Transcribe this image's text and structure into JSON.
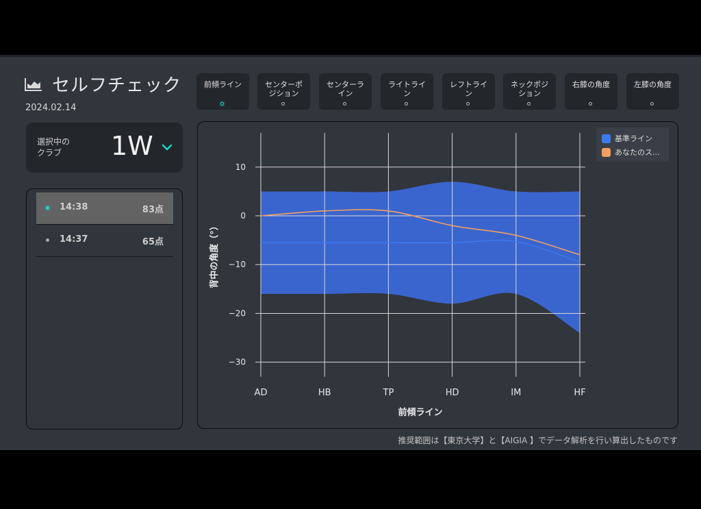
{
  "header": {
    "title": "セルフチェック",
    "date": "2024.02.14"
  },
  "club": {
    "label": "選択中の\nクラブ",
    "value": "1W"
  },
  "history": [
    {
      "time": "14:38",
      "score": "83点",
      "active": true
    },
    {
      "time": "14:37",
      "score": "65点",
      "active": false
    }
  ],
  "tabs": [
    {
      "label": "前傾ライン",
      "active": true
    },
    {
      "label": "センターポ\nジション",
      "active": false
    },
    {
      "label": "センターラ\nイン",
      "active": false
    },
    {
      "label": "ライトライ\nン",
      "active": false
    },
    {
      "label": "レフトライ\nン",
      "active": false
    },
    {
      "label": "ネックポジ\nション",
      "active": false
    },
    {
      "label": "右膝の角度",
      "active": false
    },
    {
      "label": "左膝の角度",
      "active": false
    }
  ],
  "colors": {
    "band": "#3d6de8",
    "baseline": "#3d7af0",
    "user": "#f0a060",
    "accent": "#1ed6c6"
  },
  "chart_data": {
    "type": "line",
    "xlabel": "前傾ライン",
    "ylabel": "背中の角度（°）",
    "categories": [
      "AD",
      "HB",
      "TP",
      "HD",
      "IM",
      "HF"
    ],
    "ylim": [
      -33,
      17
    ],
    "yticks": [
      10,
      0,
      -10,
      -20,
      -30
    ],
    "legend_position": "top-right",
    "grid": true,
    "band": {
      "upper": [
        5,
        5,
        5,
        7,
        5,
        5
      ],
      "lower": [
        -16,
        -16,
        -16,
        -18,
        -16,
        -24
      ]
    },
    "series": [
      {
        "name": "基準ライン",
        "values": [
          -5.5,
          -5.5,
          -5.5,
          -5.5,
          -5.3,
          -9.5
        ]
      },
      {
        "name": "あなたのス...",
        "values": [
          0,
          1,
          1,
          -2,
          -4,
          -8
        ]
      }
    ]
  },
  "footer_note": "推奨範囲は【東京大学】と【AIGIA 】でデータ解析を行い算出したものです"
}
